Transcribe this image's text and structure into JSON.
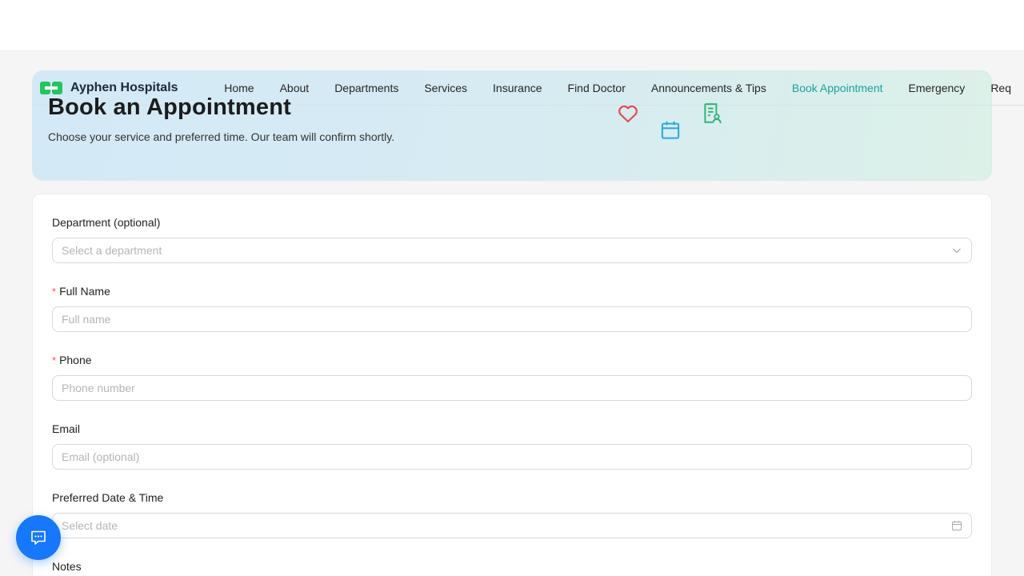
{
  "brand": {
    "name": "Ayphen Hospitals"
  },
  "nav": {
    "items": [
      {
        "label": "Home"
      },
      {
        "label": "About"
      },
      {
        "label": "Departments"
      },
      {
        "label": "Services"
      },
      {
        "label": "Insurance"
      },
      {
        "label": "Find Doctor"
      },
      {
        "label": "Announcements & Tips"
      },
      {
        "label": "Book Appointment",
        "active": true
      },
      {
        "label": "Emergency"
      },
      {
        "label": "Req"
      }
    ]
  },
  "hero": {
    "title": "Book an Appointment",
    "subtitle": "Choose your service and preferred time. Our team will confirm shortly.",
    "icons": [
      "heart-icon",
      "calendar-icon",
      "doctor-report-icon"
    ]
  },
  "form": {
    "department": {
      "label": "Department (optional)",
      "placeholder": "Select a department"
    },
    "full_name": {
      "label": "Full Name",
      "placeholder": "Full name",
      "required": true
    },
    "phone": {
      "label": "Phone",
      "placeholder": "Phone number",
      "required": true
    },
    "email": {
      "label": "Email",
      "placeholder": "Email (optional)"
    },
    "datetime": {
      "label": "Preferred Date & Time",
      "placeholder": "Select date"
    },
    "notes": {
      "label": "Notes"
    }
  },
  "required_mark": "*",
  "chat": {
    "icon": "chat-icon"
  },
  "colors": {
    "accent": "#19a39a",
    "primary": "#1677ff",
    "required": "#ff4d4f",
    "logo_green": "#22c55e"
  }
}
